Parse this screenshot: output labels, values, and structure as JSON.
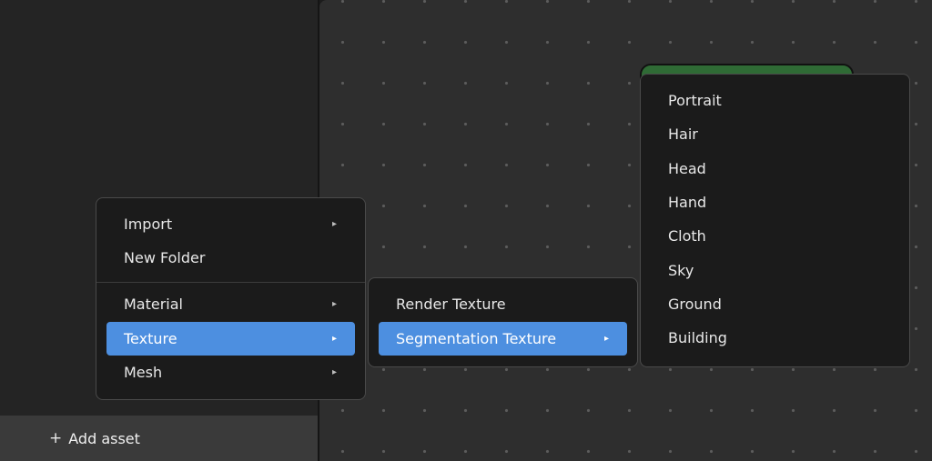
{
  "left_panel": {
    "add_asset": {
      "icon": "plus-icon",
      "plus_glyph": "+",
      "label": "Add asset"
    }
  },
  "main_menu": {
    "items": [
      {
        "label": "Import",
        "has_submenu": true
      },
      {
        "label": "New Folder",
        "has_submenu": false
      },
      {
        "label": "Material",
        "has_submenu": true
      },
      {
        "label": "Texture",
        "has_submenu": true,
        "active": true
      },
      {
        "label": "Mesh",
        "has_submenu": true
      }
    ]
  },
  "texture_menu": {
    "items": [
      {
        "label": "Render Texture",
        "has_submenu": false
      },
      {
        "label": "Segmentation Texture",
        "has_submenu": true,
        "active": true
      }
    ]
  },
  "segmentation_menu": {
    "items": [
      {
        "label": "Portrait"
      },
      {
        "label": "Hair"
      },
      {
        "label": "Head"
      },
      {
        "label": "Hand"
      },
      {
        "label": "Cloth"
      },
      {
        "label": "Sky"
      },
      {
        "label": "Ground"
      },
      {
        "label": "Building"
      }
    ]
  },
  "arrow_glyph": "▸",
  "colors": {
    "accent": "#4d8fe0",
    "node_green": "#2f6b35"
  }
}
